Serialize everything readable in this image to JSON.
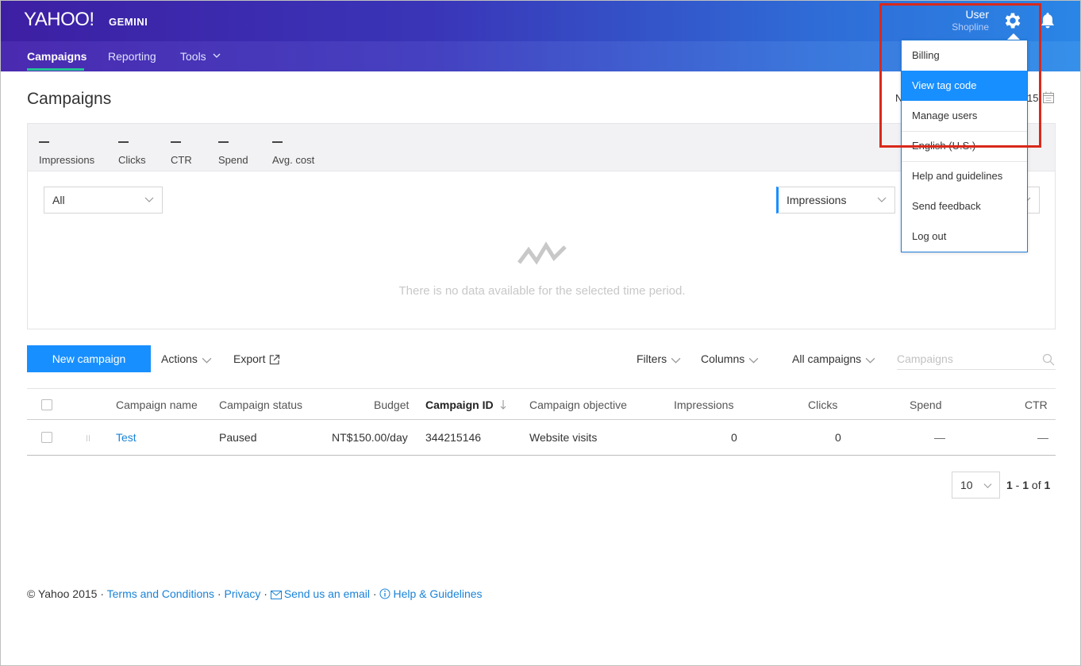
{
  "header": {
    "logo": "YAHOO!",
    "product": "GEMINI",
    "user_name": "User",
    "user_org": "Shopline"
  },
  "nav": {
    "items": [
      {
        "label": "Campaigns"
      },
      {
        "label": "Reporting"
      },
      {
        "label": "Tools"
      }
    ]
  },
  "page": {
    "title": "Campaigns",
    "date_partial": "N",
    "date_end": "15"
  },
  "stats": [
    {
      "value": "—",
      "label": "Impressions"
    },
    {
      "value": "—",
      "label": "Clicks"
    },
    {
      "value": "—",
      "label": "CTR"
    },
    {
      "value": "—",
      "label": "Spend"
    },
    {
      "value": "—",
      "label": "Avg. cost"
    }
  ],
  "chart": {
    "filter_value": "All",
    "metric_value": "Impressions",
    "no_data": "There is no data available for the selected time period."
  },
  "toolbar": {
    "new_campaign": "New campaign",
    "actions": "Actions",
    "export": "Export",
    "filters": "Filters",
    "columns": "Columns",
    "all_campaigns": "All campaigns",
    "search_placeholder": "Campaigns"
  },
  "table": {
    "headers": {
      "name": "Campaign name",
      "status": "Campaign status",
      "budget": "Budget",
      "id": "Campaign ID",
      "objective": "Campaign objective",
      "impressions": "Impressions",
      "clicks": "Clicks",
      "spend": "Spend",
      "ctr": "CTR"
    },
    "rows": [
      {
        "name": "Test",
        "status": "Paused",
        "budget": "NT$150.00/day",
        "id": "344215146",
        "objective": "Website visits",
        "impressions": "0",
        "clicks": "0",
        "spend": "—",
        "ctr": "—"
      }
    ]
  },
  "pager": {
    "page_size": "10",
    "range_start": "1",
    "range_sep": " - ",
    "range_end": "1",
    "of_word": " of ",
    "total": "1"
  },
  "footer": {
    "copyright": "© Yahoo 2015 · ",
    "terms": "Terms and Conditions",
    "sep1": " · ",
    "privacy": "Privacy",
    "sep2": " · ",
    "email": "Send us an email",
    "sep3": " · ",
    "help": "Help & Guidelines"
  },
  "menu": {
    "items": [
      {
        "label": "Billing"
      },
      {
        "label": "View tag code"
      },
      {
        "label": "Manage users"
      },
      {
        "label": "English (U.S.)"
      },
      {
        "label": "Help and guidelines"
      },
      {
        "label": "Send feedback"
      },
      {
        "label": "Log out"
      }
    ]
  },
  "colors": {
    "primary": "#188fff",
    "link": "#1a83d8",
    "nav_accent": "#24c196",
    "highlight": "#d9291c"
  }
}
